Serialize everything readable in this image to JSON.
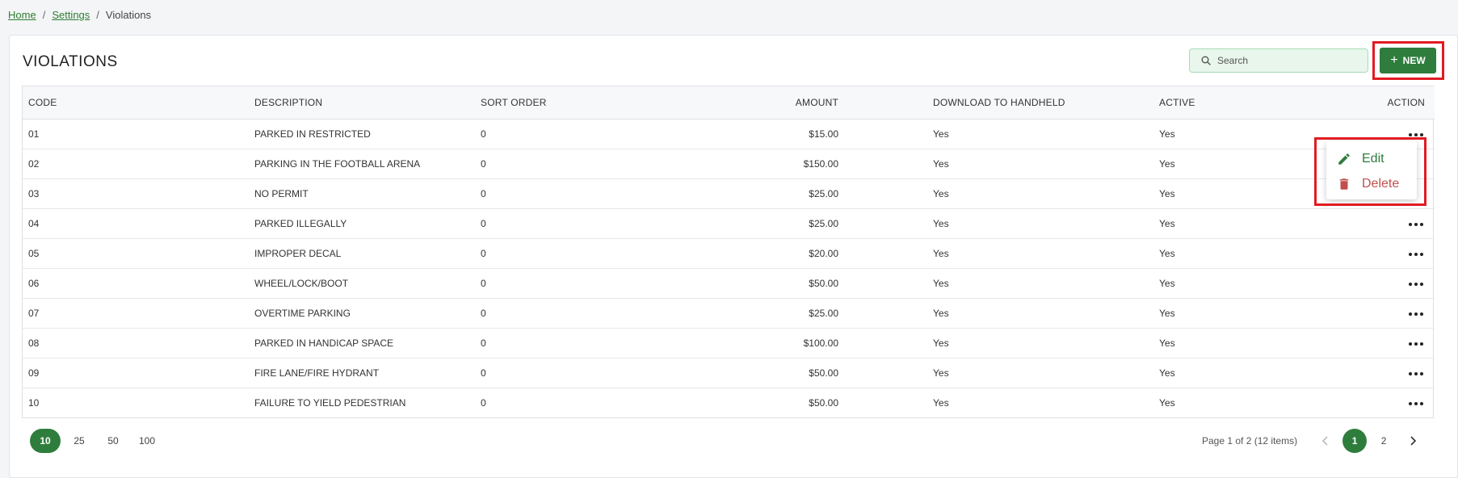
{
  "breadcrumb": {
    "home": "Home",
    "settings": "Settings",
    "current": "Violations",
    "separator": "/"
  },
  "page": {
    "title": "VIOLATIONS"
  },
  "search": {
    "placeholder": "Search",
    "value": ""
  },
  "toolbar": {
    "new_plus": "+",
    "new_label": "NEW"
  },
  "table": {
    "columns": {
      "code": "CODE",
      "description": "DESCRIPTION",
      "sort_order": "SORT ORDER",
      "amount": "AMOUNT",
      "download": "DOWNLOAD TO HANDHELD",
      "active": "ACTIVE",
      "action": "ACTION"
    },
    "rows": [
      {
        "code": "01",
        "description": "PARKED IN RESTRICTED",
        "sort_order": "0",
        "amount": "$15.00",
        "download": "Yes",
        "active": "Yes"
      },
      {
        "code": "02",
        "description": "PARKING IN THE FOOTBALL ARENA",
        "sort_order": "0",
        "amount": "$150.00",
        "download": "Yes",
        "active": "Yes"
      },
      {
        "code": "03",
        "description": "NO PERMIT",
        "sort_order": "0",
        "amount": "$25.00",
        "download": "Yes",
        "active": "Yes"
      },
      {
        "code": "04",
        "description": "PARKED ILLEGALLY",
        "sort_order": "0",
        "amount": "$25.00",
        "download": "Yes",
        "active": "Yes"
      },
      {
        "code": "05",
        "description": "IMPROPER DECAL",
        "sort_order": "0",
        "amount": "$20.00",
        "download": "Yes",
        "active": "Yes"
      },
      {
        "code": "06",
        "description": "WHEEL/LOCK/BOOT",
        "sort_order": "0",
        "amount": "$50.00",
        "download": "Yes",
        "active": "Yes"
      },
      {
        "code": "07",
        "description": "OVERTIME PARKING",
        "sort_order": "0",
        "amount": "$25.00",
        "download": "Yes",
        "active": "Yes"
      },
      {
        "code": "08",
        "description": "PARKED IN HANDICAP SPACE",
        "sort_order": "0",
        "amount": "$100.00",
        "download": "Yes",
        "active": "Yes"
      },
      {
        "code": "09",
        "description": "FIRE LANE/FIRE HYDRANT",
        "sort_order": "0",
        "amount": "$50.00",
        "download": "Yes",
        "active": "Yes"
      },
      {
        "code": "10",
        "description": "FAILURE TO YIELD PEDESTRIAN",
        "sort_order": "0",
        "amount": "$50.00",
        "download": "Yes",
        "active": "Yes"
      }
    ]
  },
  "context_menu": {
    "edit": "Edit",
    "delete": "Delete"
  },
  "pagination": {
    "page_sizes": [
      "10",
      "25",
      "50",
      "100"
    ],
    "selected_size": "10",
    "info": "Page 1 of 2 (12 items)",
    "pages": [
      "1",
      "2"
    ],
    "current_page": "1",
    "prev_glyph": "‹",
    "next_glyph": "›"
  },
  "colors": {
    "brand_green": "#2e7d3c",
    "link_green": "#2e7d32",
    "delete_red": "#c0504d",
    "highlight_red": "#e11b22",
    "search_bg": "#e8f6ec"
  },
  "icons": {
    "search": "search-icon",
    "edit": "pencil-icon",
    "delete": "trash-icon",
    "row_actions": "more-horizontal-icon"
  }
}
